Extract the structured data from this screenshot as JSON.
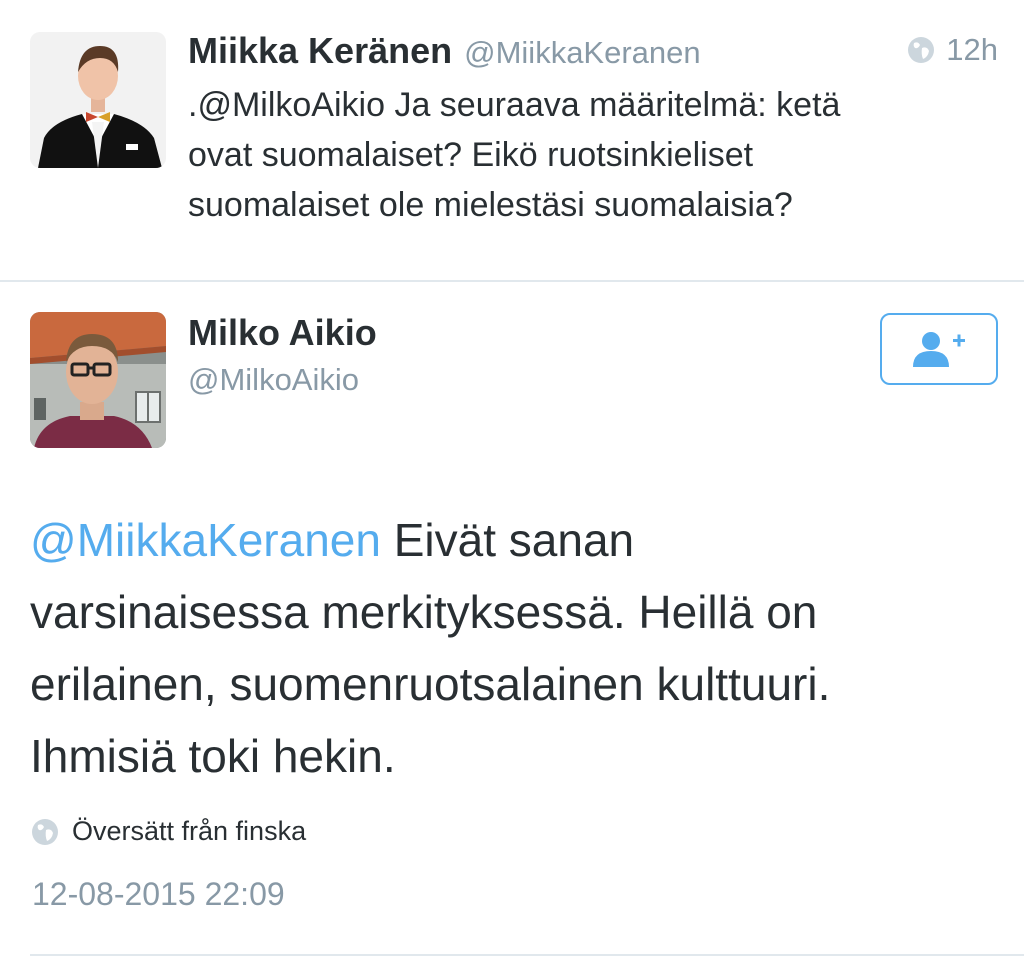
{
  "reply_tweet": {
    "author_name": "Miikka Keränen",
    "author_handle": "@MiikkaKeranen",
    "time": "12h",
    "text_lines": [
      ".@MilkoAikio Ja seuraava määritelmä: ketä",
      "ovat suomalaiset? Eikö ruotsinkieliset",
      "suomalaiset ole mielestäsi suomalaisia?"
    ],
    "avatar_icon": "person-in-tuxedo-avatar",
    "time_icon": "globe-icon"
  },
  "main_tweet": {
    "author_name": "Milko Aikio",
    "author_handle": "@MilkoAikio",
    "follow_icon": "add-user-icon",
    "avatar_icon": "person-with-glasses-avatar",
    "mention": "@MiikkaKeranen",
    "text_line1_rest": " Eivät sanan",
    "text_lines": [
      "varsinaisessa merkityksessä. Heillä on",
      "erilainen, suomenruotsalainen kulttuuri.",
      "Ihmisiä toki hekin."
    ],
    "translated_label": "Översätt från finska",
    "translated_icon": "globe-icon",
    "timestamp": "12-08-2015 22:09"
  },
  "colors": {
    "link": "#55acee",
    "text": "#292f33",
    "muted": "#8899a6",
    "divider": "#e1e8ed"
  }
}
